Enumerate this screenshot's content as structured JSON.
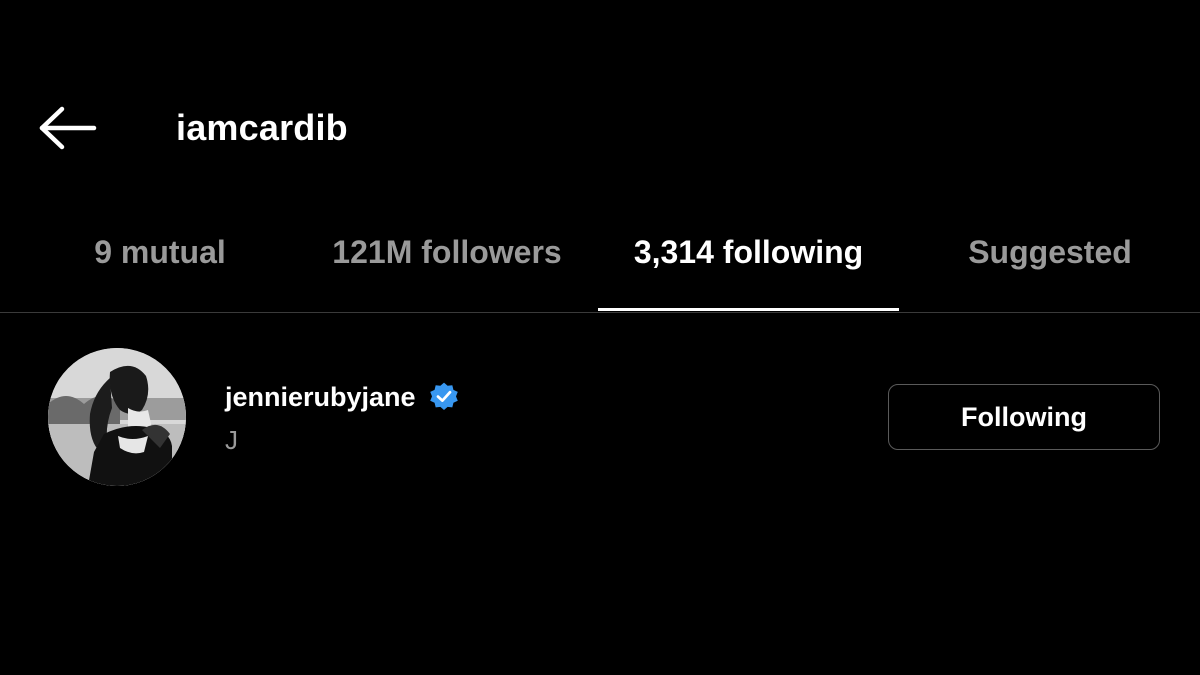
{
  "header": {
    "back_icon": "arrow-left-icon",
    "title": "iamcardib"
  },
  "tabs": [
    {
      "label": "9 mutual",
      "active": false
    },
    {
      "label": "121M followers",
      "active": false
    },
    {
      "label": "3,314 following",
      "active": true
    },
    {
      "label": "Suggested",
      "active": false
    }
  ],
  "list": [
    {
      "username": "jennierubyjane",
      "verified": true,
      "subtitle": "J",
      "button_label": "Following",
      "avatar_icon": "profile-photo"
    }
  ],
  "colors": {
    "background": "#000000",
    "text_primary": "#ffffff",
    "text_secondary": "#9a9a9a",
    "verified_blue": "#3897f0",
    "divider": "#3a3a3a"
  }
}
